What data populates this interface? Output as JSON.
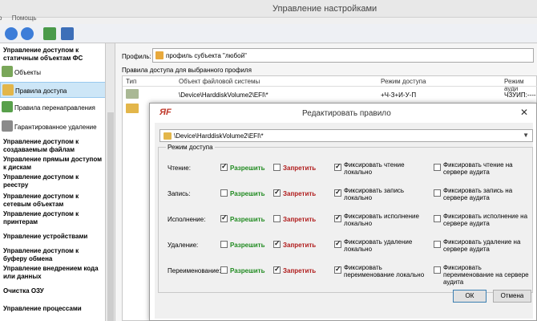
{
  "window": {
    "title": "Управление настройками"
  },
  "menu": {
    "items": [
      "о",
      "Помощь"
    ]
  },
  "sidebar": {
    "heading1": "Управление доступом к статичным объектам ФС",
    "items": [
      {
        "label": "Объекты"
      },
      {
        "label": "Правила доступа"
      },
      {
        "label": "Правила перенаправления"
      },
      {
        "label": "Гарантированное удаление"
      }
    ],
    "headings": [
      "Управление доступом к создаваемым файлам",
      "Управление прямым доступом к дискам",
      "Управление доступом к реестру",
      "Управление доступом к сетевым объектам",
      "Управление доступом к принтерам",
      "Управление устройствами",
      "Управление доступом к буферу обмена",
      "Управление внедрением кода или данных",
      "Очистка ОЗУ",
      "Управление процессами"
    ]
  },
  "main": {
    "profile_label": "Профиль:",
    "profile_value": "профиль субъекта \"любой\"",
    "rules_caption": "Правила доступа для выбранного профиля",
    "columns": [
      "Тип",
      "Объект файловой системы",
      "Режим доступа",
      "Режим ауди"
    ],
    "rows": [
      {
        "object": "\\Device\\HarddiskVolume2\\EFI\\*",
        "mode": "+Ч-З+И-У-П",
        "audit": "ЧЗУИП:----"
      }
    ]
  },
  "dialog": {
    "logo": "ЯF",
    "title": "Редактировать правило",
    "close": "✕",
    "path": "\\Device\\HarddiskVolume2\\EFI\\*",
    "group_title": "Режим доступа",
    "allow_label": "Разрешить",
    "deny_label": "Запретить",
    "fix_local_prefix": "Фиксировать",
    "ops": [
      {
        "name": "Чтение:",
        "allow": true,
        "deny": false,
        "fix_local": true,
        "fix_audit": false,
        "fix_local_label": "Фиксировать чтение локально",
        "fix_audit_label": "Фиксировать чтение на сервере аудита"
      },
      {
        "name": "Запись:",
        "allow": false,
        "deny": true,
        "fix_local": true,
        "fix_audit": false,
        "fix_local_label": "Фиксировать запись локально",
        "fix_audit_label": "Фиксировать запись на сервере аудита"
      },
      {
        "name": "Исполнение:",
        "allow": true,
        "deny": false,
        "fix_local": true,
        "fix_audit": false,
        "fix_local_label": "Фиксировать исполнение локально",
        "fix_audit_label": "Фиксировать исполнение на сервере аудита"
      },
      {
        "name": "Удаление:",
        "allow": false,
        "deny": true,
        "fix_local": true,
        "fix_audit": false,
        "fix_local_label": "Фиксировать удаление локально",
        "fix_audit_label": "Фиксировать удаление на сервере аудита"
      },
      {
        "name": "Переименование:",
        "allow": false,
        "deny": true,
        "fix_local": true,
        "fix_audit": false,
        "fix_local_label": "Фиксировать переименование локально",
        "fix_audit_label": "Фиксировать переименование на сервере аудита"
      }
    ],
    "ok_label": "ОК",
    "cancel_label": "Отмена"
  },
  "colors": {
    "allow": "#1f8a1f",
    "deny": "#b01c1c",
    "selection": "#cde6f7"
  }
}
